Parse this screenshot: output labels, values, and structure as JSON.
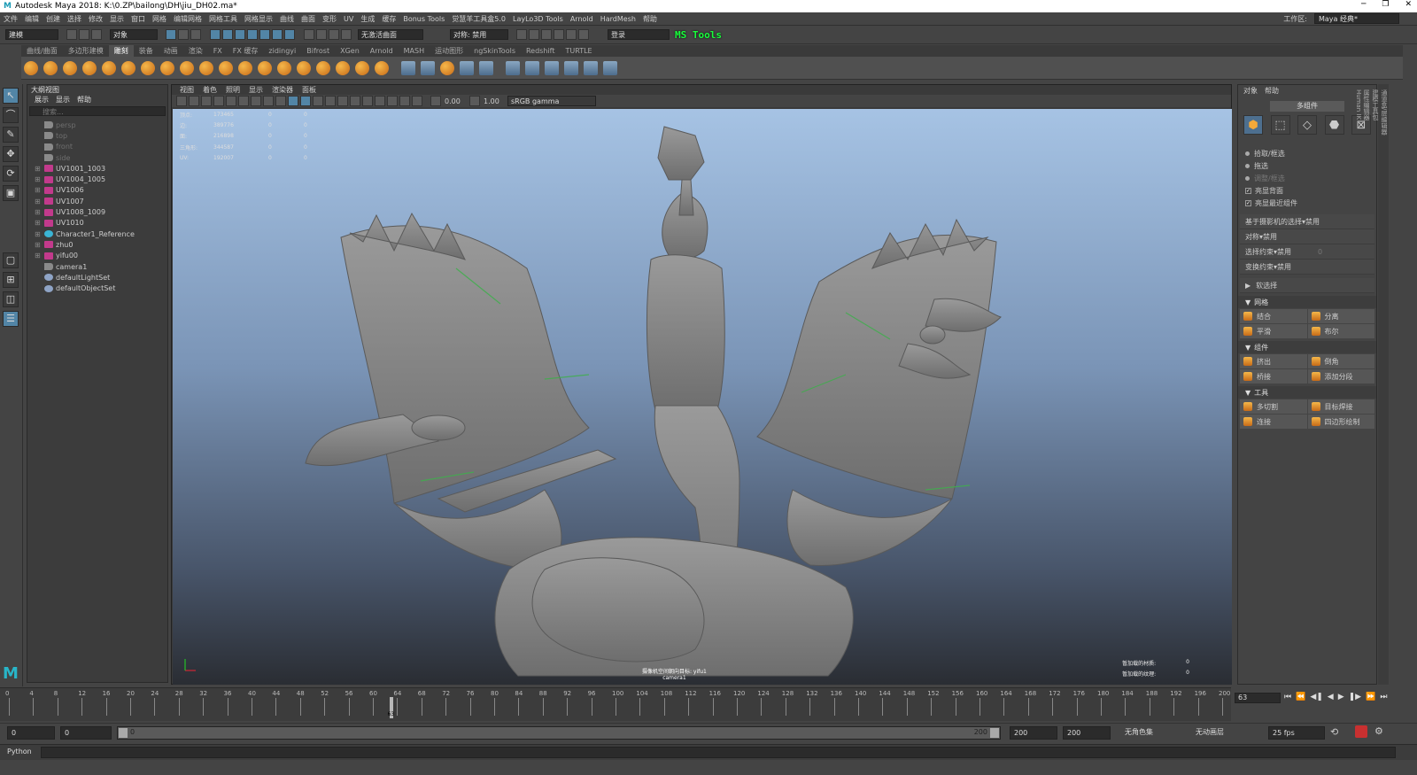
{
  "window": {
    "title": "Autodesk Maya 2018: K:\\0.ZP\\bailong\\DH\\jiu_DH02.ma*",
    "logo": "M",
    "controls": [
      "─",
      "❐",
      "✕"
    ]
  },
  "menubar": {
    "items": [
      "文件",
      "编辑",
      "创建",
      "选择",
      "修改",
      "显示",
      "窗口",
      "网格",
      "编辑网格",
      "网格工具",
      "网格显示",
      "曲线",
      "曲面",
      "变形",
      "UV",
      "生成",
      "缓存",
      "Bonus Tools",
      "觉慧羊工具盒5.0",
      "LayLo3D Tools",
      "Arnold",
      "HardMesh",
      "帮助"
    ],
    "workspace_label": "工作区:",
    "workspace_value": "Maya 经典*"
  },
  "statusline": {
    "mode": "建模",
    "object_label": "对象",
    "surface": "无激活曲面",
    "symmetry": "对称: 禁用",
    "login": "登录",
    "mstools": "MS Tools"
  },
  "shelf_tabs": [
    "曲线/曲面",
    "多边形建模",
    "雕刻",
    "装备",
    "动画",
    "渲染",
    "FX",
    "FX 缓存",
    "zidingyi",
    "Bifrost",
    "XGen",
    "Arnold",
    "MASH",
    "运动图形",
    "ngSkinTools",
    "Redshift",
    "TURTLE"
  ],
  "shelf_active_index": 2,
  "outliner": {
    "title": "大纲视图",
    "menu": [
      "展示",
      "显示",
      "帮助"
    ],
    "search_placeholder": "搜索...",
    "items": [
      {
        "label": "persp",
        "kind": "cam",
        "dim": true,
        "exp": false
      },
      {
        "label": "top",
        "kind": "cam",
        "dim": true,
        "exp": false
      },
      {
        "label": "front",
        "kind": "cam",
        "dim": true,
        "exp": false
      },
      {
        "label": "side",
        "kind": "cam",
        "dim": true,
        "exp": false
      },
      {
        "label": "UV1001_1003",
        "kind": "mesh",
        "dim": false,
        "exp": true
      },
      {
        "label": "UV1004_1005",
        "kind": "mesh",
        "dim": false,
        "exp": true
      },
      {
        "label": "UV1006",
        "kind": "mesh",
        "dim": false,
        "exp": true
      },
      {
        "label": "UV1007",
        "kind": "mesh",
        "dim": false,
        "exp": true
      },
      {
        "label": "UV1008_1009",
        "kind": "mesh",
        "dim": false,
        "exp": true
      },
      {
        "label": "UV1010",
        "kind": "mesh",
        "dim": false,
        "exp": true
      },
      {
        "label": "Character1_Reference",
        "kind": "ref",
        "dim": false,
        "exp": true
      },
      {
        "label": "zhu0",
        "kind": "mesh",
        "dim": false,
        "exp": true
      },
      {
        "label": "yifu00",
        "kind": "mesh",
        "dim": false,
        "exp": true
      },
      {
        "label": "camera1",
        "kind": "cam",
        "dim": false,
        "exp": false
      },
      {
        "label": "defaultLightSet",
        "kind": "set",
        "dim": false,
        "exp": false
      },
      {
        "label": "defaultObjectSet",
        "kind": "set",
        "dim": false,
        "exp": false
      }
    ]
  },
  "viewport": {
    "menu": [
      "视图",
      "着色",
      "照明",
      "显示",
      "渲染器",
      "面板"
    ],
    "exposure": "0.00",
    "gamma": "1.00",
    "colorspace": "sRGB gamma",
    "hud": [
      {
        "k": "顶点:",
        "v": "173465",
        "a": "0",
        "b": "0"
      },
      {
        "k": "边:",
        "v": "389776",
        "a": "0",
        "b": "0"
      },
      {
        "k": "面:",
        "v": "216898",
        "a": "0",
        "b": "0"
      },
      {
        "k": "三角形:",
        "v": "344587",
        "a": "0",
        "b": "0"
      },
      {
        "k": "UV:",
        "v": "192007",
        "a": "0",
        "b": "0"
      }
    ],
    "hud_right": [
      {
        "k": "暂加载的材质:",
        "v": "0"
      },
      {
        "k": "暂加载的纹理:",
        "v": "0"
      }
    ],
    "camera_note": "摄像机空间朝向目标: yifu1",
    "camera": "camera1"
  },
  "modeling_toolkit": {
    "tabs": [
      "对象",
      "帮助"
    ],
    "mode_header": "多组件",
    "radios": [
      {
        "label": "拾取/框选",
        "dim": false
      },
      {
        "label": "拖选",
        "dim": false
      },
      {
        "label": "调整/框选",
        "dim": true
      }
    ],
    "checks": [
      "亮显背面",
      "亮显最近组件"
    ],
    "props": [
      {
        "k": "基于摄影机的选择",
        "v": "禁用"
      },
      {
        "k": "对称",
        "v": "禁用"
      },
      {
        "k": "选择约束",
        "v": "禁用",
        "extra": "0"
      },
      {
        "k": "变换约束",
        "v": "禁用"
      }
    ],
    "soft_select": "软选择",
    "sections": [
      {
        "title": "网格",
        "buttons": [
          "结合",
          "分离",
          "平滑",
          "布尔"
        ]
      },
      {
        "title": "组件",
        "buttons": [
          "挤出",
          "倒角",
          "桥接",
          "添加分段"
        ]
      },
      {
        "title": "工具",
        "buttons": [
          "多切割",
          "目标焊接",
          "连接",
          "四边形绘制"
        ]
      }
    ]
  },
  "sidetabs": [
    "通道盒/层编辑器",
    "建模工具包",
    "属性编辑器",
    "Human IK"
  ],
  "timeline": {
    "ticks": [
      "0",
      "4",
      "8",
      "12",
      "16",
      "20",
      "24",
      "28",
      "32",
      "36",
      "40",
      "44",
      "48",
      "52",
      "56",
      "60",
      "64",
      "68",
      "72",
      "76",
      "80",
      "84",
      "88",
      "92",
      "96",
      "100",
      "104",
      "108",
      "112",
      "116",
      "120",
      "124",
      "128",
      "132",
      "136",
      "140",
      "144",
      "148",
      "152",
      "156",
      "160",
      "164",
      "168",
      "172",
      "176",
      "180",
      "184",
      "188",
      "192",
      "196",
      "200"
    ],
    "current": "63",
    "current_frame": 63,
    "max": 200
  },
  "playback": [
    "⏮",
    "⏪",
    "◀❚",
    "◀",
    "▶",
    "❚▶",
    "⏩",
    "⏭"
  ],
  "range": {
    "start": "0",
    "start2": "0",
    "slider_start": "0",
    "slider_end": "200",
    "end": "200",
    "end2": "200",
    "charset": "无角色集",
    "anim_layer": "无动画层",
    "fps": "25 fps"
  },
  "scriptline": {
    "lang": "Python"
  }
}
